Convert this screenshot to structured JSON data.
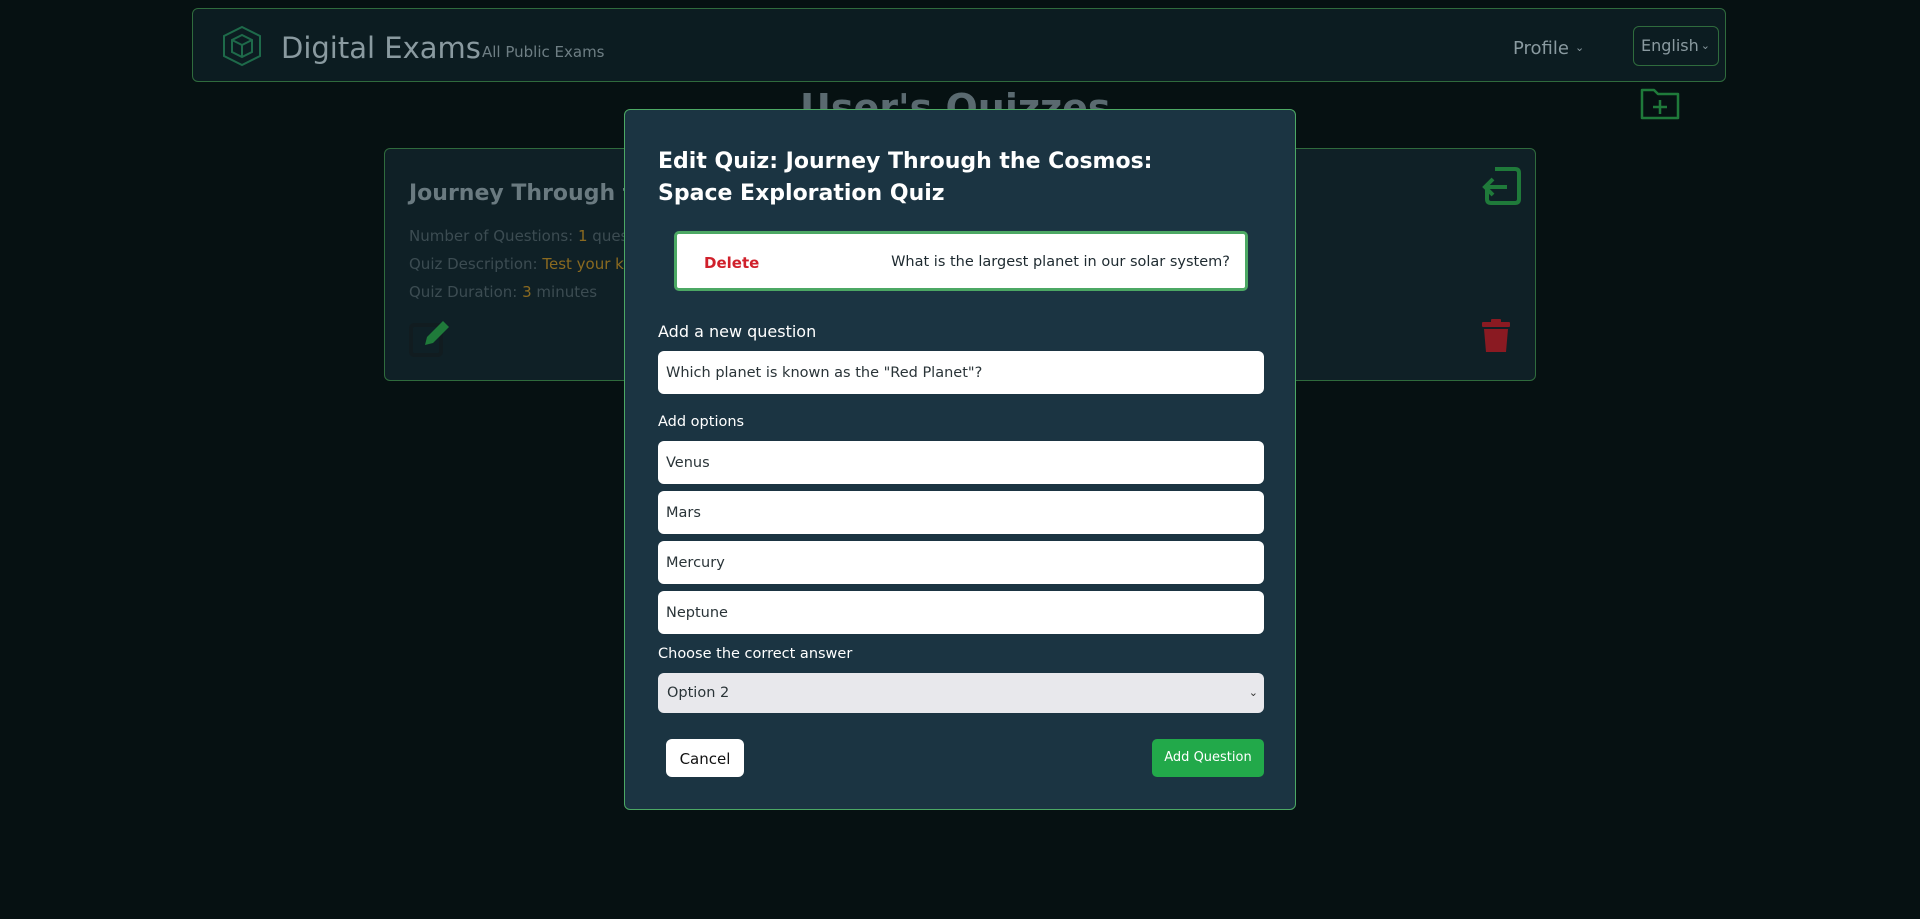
{
  "navbar": {
    "brand": "Digital Exams",
    "link": "All Public Exams",
    "profile": "Profile",
    "language": "English"
  },
  "page": {
    "title": "User's Quizzes"
  },
  "quiz_card": {
    "title": "Journey Through the Cosmos: Space Exploration Quiz",
    "questions_label": "Number of Questions: ",
    "questions_value": "1",
    "questions_unit": " questions",
    "description_label": "Quiz Description: ",
    "description_value": "Test your knowledge",
    "duration_label": "Quiz Duration: ",
    "duration_value": "3",
    "duration_unit": " minutes"
  },
  "modal": {
    "title": "Edit Quiz: Journey Through the Cosmos: Space Exploration Quiz",
    "existing_question": {
      "delete_label": "Delete",
      "text": "What is the largest planet in our solar system?"
    },
    "new_question_label": "Add a new question",
    "new_question_value": "Which planet is known as the \"Red Planet\"?",
    "options_label": "Add options",
    "options": [
      "Venus",
      "Mars",
      "Mercury",
      "Neptune"
    ],
    "answer_label": "Choose the correct answer",
    "answer_selected": "Option 2",
    "cancel_label": "Cancel",
    "add_label": "Add Question"
  },
  "colors": {
    "background": "#061112",
    "modal_bg": "#1b3442",
    "accent_green": "#22a94a",
    "border_green": "#4ca864",
    "danger_red": "#d0202b"
  }
}
